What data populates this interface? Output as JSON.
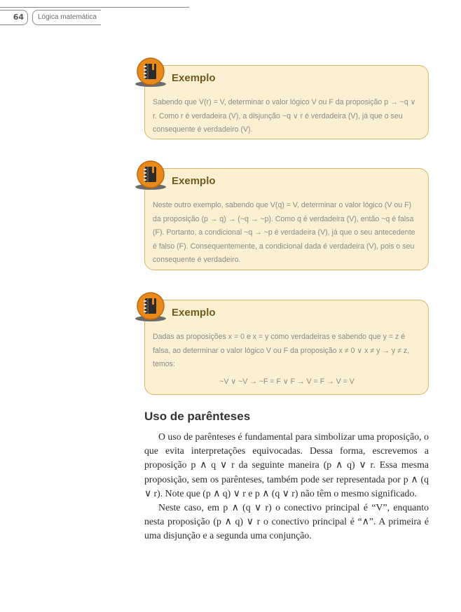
{
  "header": {
    "page_number": "64",
    "title": "Lógica matemática"
  },
  "colors": {
    "box_background": "#fbf0d2",
    "box_border": "#d8b66a",
    "badge_orange": "#e8891c",
    "title_brown": "#6f5b1e"
  },
  "examples": [
    {
      "icon": "notebook-icon",
      "title": "Exemplo",
      "text": "Sabendo que V(r) = V, determinar o valor lógico V ou F da proposição p → ~q ∨ r. Como r é verdadeira (V), a disjunção ~q ∨ r é verdadeira (V), já que o seu consequente é verdadeiro (V)."
    },
    {
      "icon": "notebook-icon",
      "title": "Exemplo",
      "text": "Neste outro exemplo, sabendo que V(q) = V, determinar o valor lógico (V ou F) da proposição (p → q) → (~q → ~p). Como q é verdadeira (V), então ~q é falsa (F). Portanto, a condicional ~q → ~p é verdadeira (V), já que o seu antecedente é falso (F). Consequentemente, a condicional dada é verdadeira (V), pois o seu consequente é verdadeiro."
    },
    {
      "icon": "notebook-icon",
      "title": "Exemplo",
      "text": "Dadas as proposições x = 0 e x = y como verdadeiras e sabendo que y = z é falsa, ao determinar o valor lógico V ou F da proposição x ≠ 0 ∨ x ≠ y → y ≠ z, temos:",
      "formula": "~V ∨ ~V → ~F = F ∨ F → V = F → V = V"
    }
  ],
  "section": {
    "title": "Uso de parênteses",
    "paragraphs": [
      "O uso de parênteses é fundamental para simbolizar uma proposição, o que evita interpretações equivocadas. Dessa forma, escrevemos a proposição p ∧ q ∨ r da seguinte maneira (p ∧ q) ∨ r. Essa mesma proposição, sem os parênteses, também pode ser representada por p ∧ (q ∨ r). Note que (p ∧ q) ∨ r e p ∧ (q ∨ r) não têm o mesmo significado.",
      "Neste caso, em p ∧ (q ∨ r) o conectivo principal é “V”, enquanto nesta proposição (p ∧ q) ∨ r o conectivo principal é “∧”. A primeira é uma disjunção e a segunda uma conjunção."
    ]
  }
}
